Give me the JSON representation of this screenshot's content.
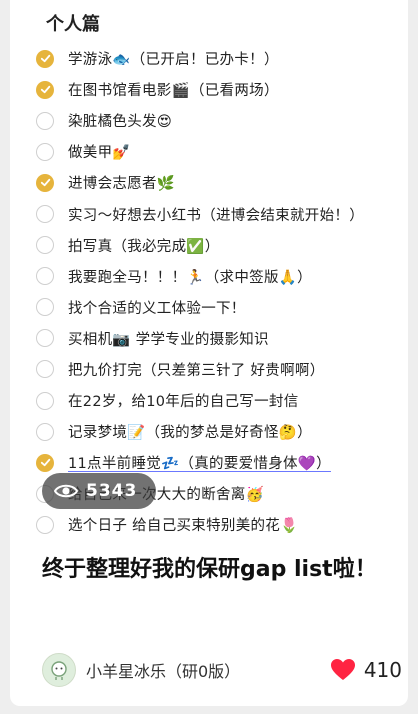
{
  "section_title": "个人篇",
  "items": [
    {
      "text": "学游泳🐟（已开启！已办卡！）",
      "done": true
    },
    {
      "text": "在图书馆看电影🎬（已看两场）",
      "done": true
    },
    {
      "text": "染脏橘色头发😍",
      "done": false
    },
    {
      "text": "做美甲💅",
      "done": false
    },
    {
      "text": "进博会志愿者🌿",
      "done": true
    },
    {
      "text": "实习～好想去小红书（进博会结束就开始！）",
      "done": false
    },
    {
      "text": "拍写真（我必完成✅）",
      "done": false
    },
    {
      "text": "我要跑全马！！！🏃（求中签版🙏）",
      "done": false
    },
    {
      "text": "找个合适的义工体验一下！",
      "done": false
    },
    {
      "text": "买相机📷 学学专业的摄影知识",
      "done": false
    },
    {
      "text": "把九价打完（只差第三针了 好贵啊啊）",
      "done": false
    },
    {
      "text": "在22岁，给10年后的自己写一封信",
      "done": false
    },
    {
      "text": "记录梦境📝（我的梦总是好奇怪🤔）",
      "done": false
    },
    {
      "text": "11点半前睡觉💤（真的要爱惜身体💜）",
      "done": true,
      "underline": true
    },
    {
      "text": "给自己来一次大大的断舍离🥳",
      "done": false
    },
    {
      "text": "选个日子 给自己买束特别美的花🌷",
      "done": false
    }
  ],
  "views": {
    "count": "5343",
    "icon": "eye-icon"
  },
  "headline": "终于整理好我的保研gap list啦！",
  "author": {
    "name": "小羊星冰乐（研0版）",
    "icon": "avatar"
  },
  "likes": {
    "count": "410",
    "icon": "heart-icon",
    "color": "#ff2442"
  },
  "colors": {
    "check_done": "#e6b43c",
    "check_open_border": "#cfcfcf"
  }
}
